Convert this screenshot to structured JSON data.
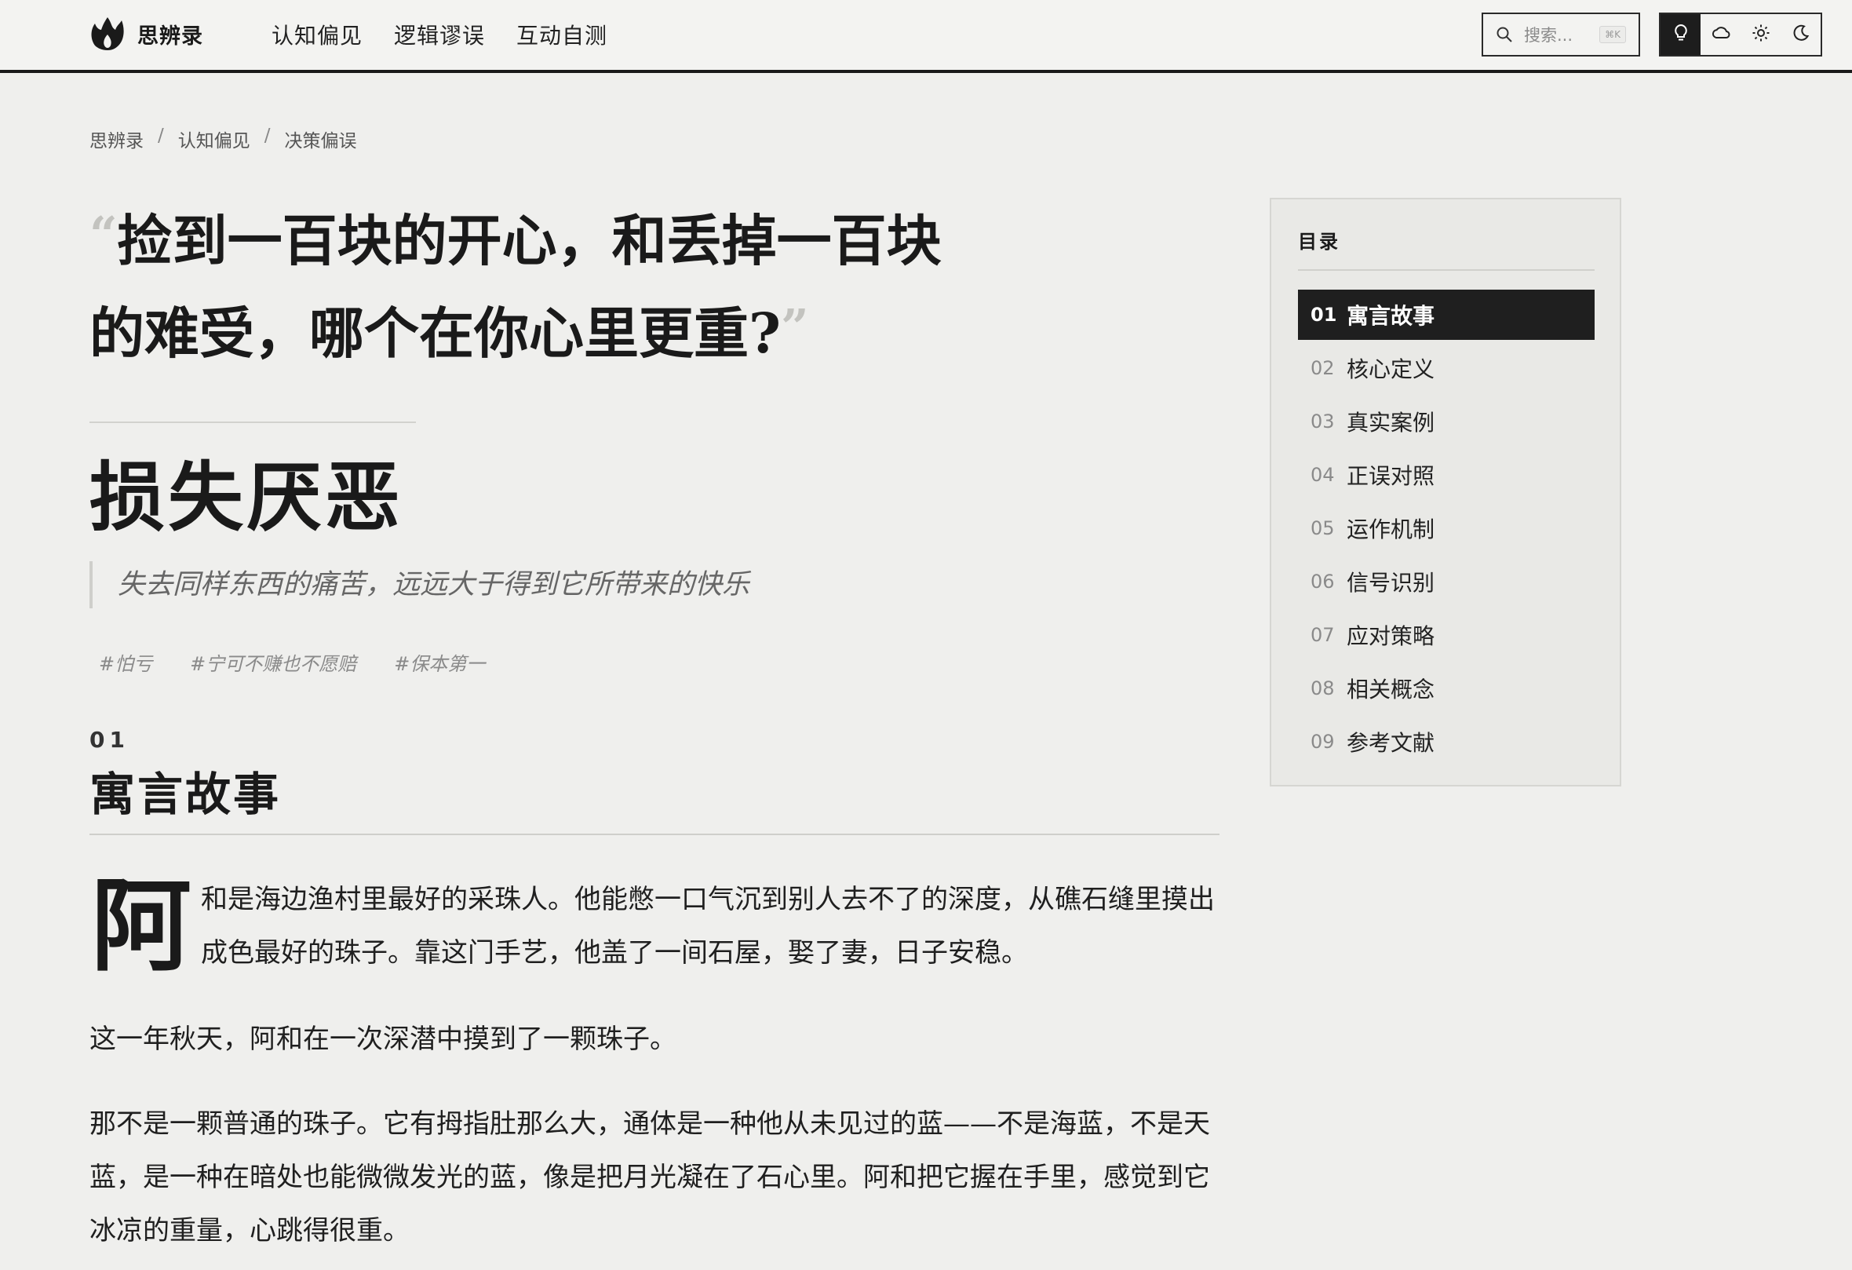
{
  "header": {
    "brand": "思辨录",
    "logo_icon": "flame-logo-icon",
    "nav": [
      {
        "label": "认知偏见"
      },
      {
        "label": "逻辑谬误"
      },
      {
        "label": "互动自测"
      }
    ],
    "search": {
      "placeholder": "搜索...",
      "shortcut": "⌘K"
    },
    "themes": [
      {
        "icon": "lightbulb-icon",
        "active": true
      },
      {
        "icon": "cloud-icon",
        "active": false
      },
      {
        "icon": "sun-icon",
        "active": false
      },
      {
        "icon": "moon-icon",
        "active": false
      }
    ]
  },
  "breadcrumb": [
    "思辨录",
    "认知偏见",
    "决策偏误"
  ],
  "breadcrumb_separator": "/",
  "hero": {
    "open_quote": "“",
    "close_quote": "”",
    "question": "捡到一百块的开心，和丢掉一百块的难受，哪个在你心里更重?",
    "title": "损失厌恶",
    "subtitle": "失去同样东西的痛苦，远远大于得到它所带来的快乐",
    "tags": [
      "#怕亏",
      "#宁可不赚也不愿赔",
      "#保本第一"
    ]
  },
  "section": {
    "number": "01",
    "title": "寓言故事",
    "dropcap": "阿",
    "paragraphs": [
      "和是海边渔村里最好的采珠人。他能憋一口气沉到别人去不了的深度，从礁石缝里摸出成色最好的珠子。靠这门手艺，他盖了一间石屋，娶了妻，日子安稳。",
      "这一年秋天，阿和在一次深潜中摸到了一颗珠子。",
      "那不是一颗普通的珠子。它有拇指肚那么大，通体是一种他从未见过的蓝——不是海蓝，不是天蓝，是一种在暗处也能微微发光的蓝，像是把月光凝在了石心里。阿和把它握在手里，感觉到它冰凉的重量，心跳得很重。"
    ]
  },
  "toc": {
    "title": "目录",
    "items": [
      {
        "num": "01",
        "label": "寓言故事",
        "active": true
      },
      {
        "num": "02",
        "label": "核心定义",
        "active": false
      },
      {
        "num": "03",
        "label": "真实案例",
        "active": false
      },
      {
        "num": "04",
        "label": "正误对照",
        "active": false
      },
      {
        "num": "05",
        "label": "运作机制",
        "active": false
      },
      {
        "num": "06",
        "label": "信号识别",
        "active": false
      },
      {
        "num": "07",
        "label": "应对策略",
        "active": false
      },
      {
        "num": "08",
        "label": "相关概念",
        "active": false
      },
      {
        "num": "09",
        "label": "参考文献",
        "active": false
      }
    ]
  },
  "colors": {
    "background": "#efefed",
    "ink": "#1a1a1a",
    "active_bg": "#1f1f1f",
    "muted": "#8a8a8a"
  }
}
